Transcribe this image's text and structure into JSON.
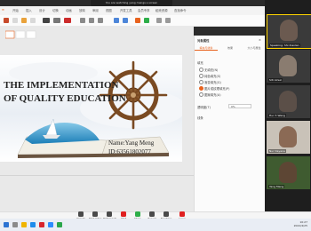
{
  "share_banner": {
    "text": "You are watching yang mengs s screen"
  },
  "menubar": {
    "items": [
      "开始",
      "插入",
      "设计",
      "切换",
      "动画",
      "放映",
      "审阅",
      "视图",
      "开发工具",
      "会员专享",
      "稻壳资源",
      "查找命令"
    ]
  },
  "slide": {
    "title_line1": "THE IMPLEMENTATION",
    "title_line2": "OF QUALITY EDUCATION",
    "name_line": "Name:Yang Meng",
    "id_line": "ID:63561802077"
  },
  "pane": {
    "header": "对象属性",
    "tabs": [
      "填充与线条",
      "效果",
      "大小与属性"
    ],
    "section_fill": "填充",
    "fill_options": [
      "无填充(N)",
      "纯色填充(S)",
      "渐变填充(G)",
      "图片或纹理填充(P)",
      "图案填充(A)"
    ],
    "transparency_label": "透明度(T)",
    "transparency_value": "0%",
    "line_label": "线条"
  },
  "participants": [
    {
      "name": "Speaking: Shi Xiaolan",
      "bg": "#6b5a50"
    },
    {
      "name": "Siti Ainun",
      "bg": "#8a7c70"
    },
    {
      "name": "Hui Yi Wang",
      "bg": "#5b4f48"
    },
    {
      "name": "Nur Dayana",
      "bg": "#d9d3cb"
    },
    {
      "name": "Yang Meng",
      "bg": "#4d6a3a"
    }
  ],
  "zoom_controls": [
    {
      "label": "Unmute",
      "color": "#4a4a4a"
    },
    {
      "label": "Start Video",
      "color": "#4a4a4a"
    },
    {
      "label": "Participants",
      "color": "#4a4a4a"
    },
    {
      "label": "Chat",
      "color": "#e02020"
    },
    {
      "label": "Share",
      "color": "#2eae49"
    },
    {
      "label": "Record",
      "color": "#4a4a4a"
    },
    {
      "label": "Reactions",
      "color": "#4a4a4a"
    },
    {
      "label": "Leave",
      "color": "#e02020"
    }
  ],
  "clock": {
    "time": "10:27",
    "date": "2022/4/25"
  },
  "colors": {
    "accent": "#e8631f",
    "zoom_blue": "#2d8cff"
  }
}
